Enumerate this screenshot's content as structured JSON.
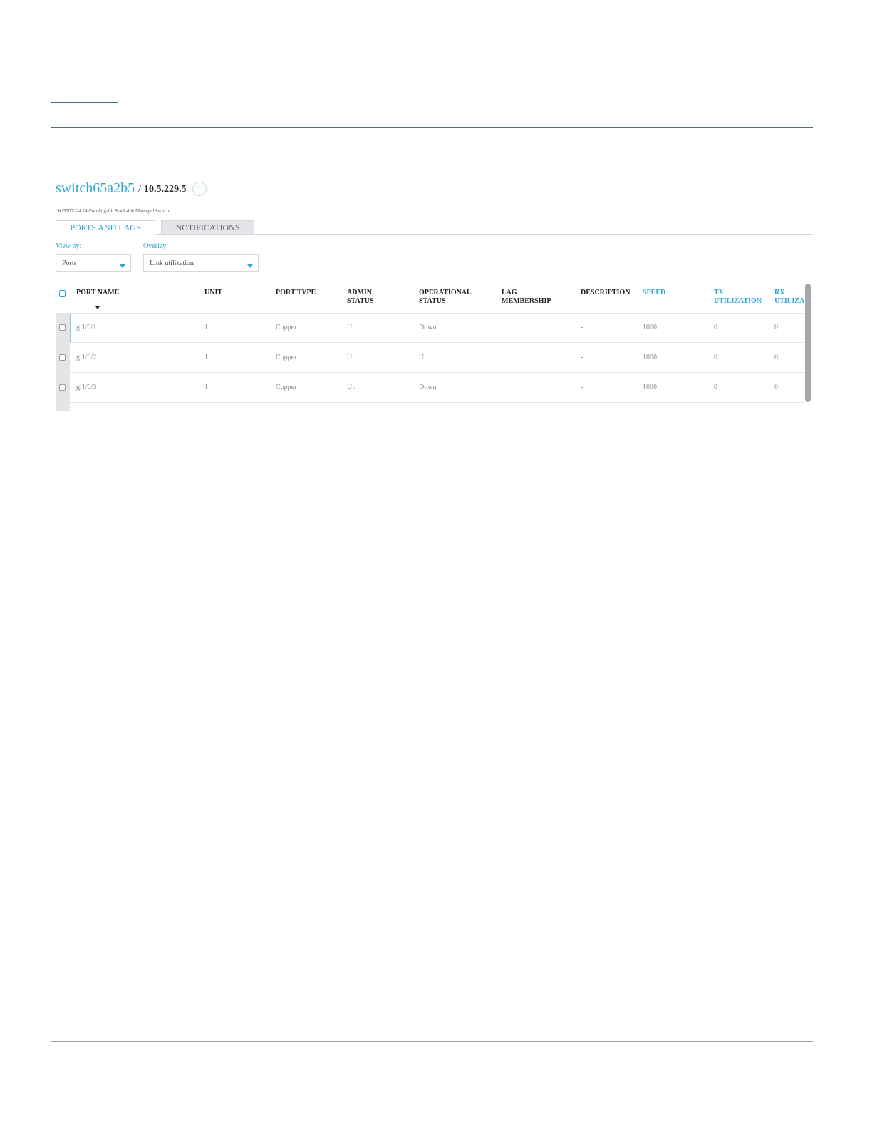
{
  "device": {
    "name": "switch65a2b5",
    "separator": "/",
    "ip": "10.5.229.5",
    "more_label": "···",
    "model": "SG550X-24 24-Port Gigabit Stackable Managed Switch"
  },
  "tabs": [
    {
      "label": "PORTS AND LAGS",
      "active": true
    },
    {
      "label": "NOTIFICATIONS",
      "active": false
    }
  ],
  "filters": {
    "view_by": {
      "label": "View by:",
      "value": "Ports"
    },
    "overlay": {
      "label": "Overlay:",
      "value": "Link utilization"
    }
  },
  "table": {
    "columns": [
      {
        "label": "PORT NAME",
        "sortable": true,
        "highlight": false
      },
      {
        "label": "UNIT",
        "highlight": false
      },
      {
        "label": "PORT TYPE",
        "highlight": false
      },
      {
        "label": "ADMIN\nSTATUS",
        "highlight": false
      },
      {
        "label": "OPERATIONAL\nSTATUS",
        "highlight": false
      },
      {
        "label": "LAG\nMEMBERSHIP",
        "highlight": false
      },
      {
        "label": "DESCRIPTION",
        "highlight": false
      },
      {
        "label": "SPEED",
        "highlight": true
      },
      {
        "label": "TX\nUTILIZATION",
        "highlight": true
      },
      {
        "label": "RX\nUTILIZA",
        "highlight": true
      }
    ],
    "rows": [
      {
        "port_name": "gi1/0/1",
        "unit": "1",
        "port_type": "Copper",
        "admin_status": "Up",
        "operational_status": "Down",
        "lag_membership": "",
        "description": "-",
        "speed": "1000",
        "tx_utilization": "0",
        "rx_utilization": "0"
      },
      {
        "port_name": "gi1/0/2",
        "unit": "1",
        "port_type": "Copper",
        "admin_status": "Up",
        "operational_status": "Up",
        "lag_membership": "",
        "description": "-",
        "speed": "1000",
        "tx_utilization": "0",
        "rx_utilization": "0"
      },
      {
        "port_name": "gi1/0/3",
        "unit": "1",
        "port_type": "Copper",
        "admin_status": "Up",
        "operational_status": "Down",
        "lag_membership": "",
        "description": "-",
        "speed": "1000",
        "tx_utilization": "0",
        "rx_utilization": "0"
      }
    ]
  },
  "colors": {
    "accent": "#2fa7d6",
    "frame": "#3a6f8f",
    "tab_inactive_bg": "#e3e5e8"
  }
}
